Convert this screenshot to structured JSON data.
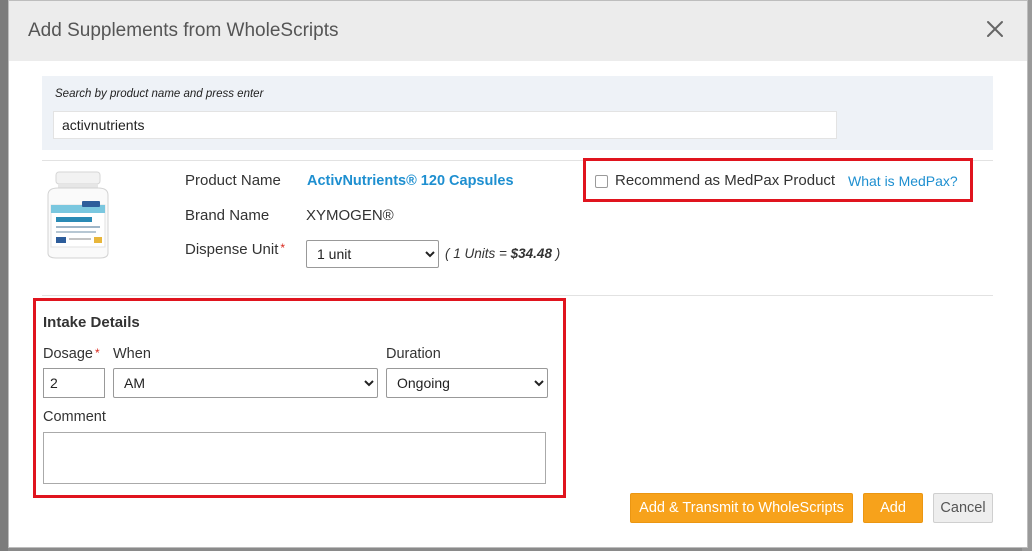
{
  "modal": {
    "title": "Add Supplements from WholeScripts"
  },
  "search": {
    "label": "Search by product name and press enter",
    "value": "activnutrients"
  },
  "product": {
    "name_label": "Product Name",
    "name_value": "ActivNutrients® 120 Capsules",
    "brand_label": "Brand Name",
    "brand_value": "XYMOGEN®",
    "dispense_label": "Dispense Unit",
    "required_mark": "*",
    "dispense_selected": "1 unit",
    "unit_note_prefix": "( 1 Units = ",
    "unit_price": "$34.48",
    "unit_note_suffix": " )"
  },
  "medpax": {
    "label": "Recommend as MedPax Product",
    "link": "What is MedPax?",
    "checked": false
  },
  "intake": {
    "title": "Intake Details",
    "dosage_label": "Dosage",
    "dosage_value": "2",
    "when_label": "When",
    "when_selected": "AM",
    "duration_label": "Duration",
    "duration_selected": "Ongoing",
    "comment_label": "Comment",
    "comment_value": ""
  },
  "buttons": {
    "transmit": "Add & Transmit to WholeScripts",
    "add": "Add",
    "cancel": "Cancel"
  },
  "colors": {
    "accent_orange": "#f7a21b",
    "link_blue": "#1e8fd0",
    "highlight_red": "#e0141e",
    "header_bg": "#ececec",
    "search_bg": "#eef2f7"
  },
  "icons": {
    "close": "close-icon",
    "checkbox": "checkbox-icon",
    "product_image": "supplement-bottle-icon"
  }
}
